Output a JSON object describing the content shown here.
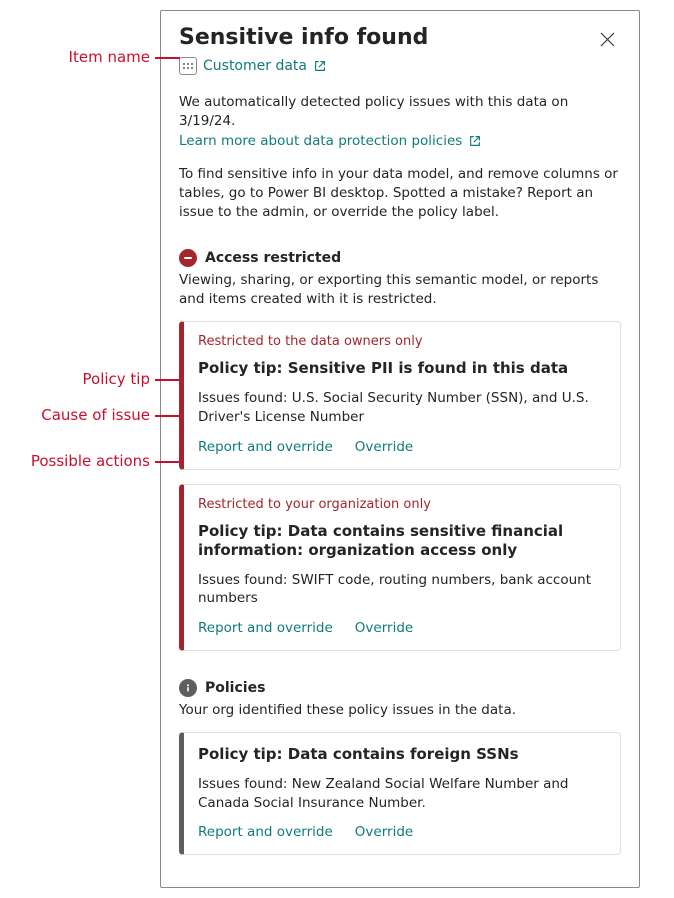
{
  "annotations": {
    "item_name": "Item name",
    "policy_tip": "Policy tip",
    "cause_of_issue": "Cause of issue",
    "possible_actions": "Possible actions"
  },
  "dialog": {
    "title": "Sensitive info found",
    "item_name": "Customer data",
    "detected_text": "We automatically detected policy issues with this data on 3/19/24.",
    "learn_more": "Learn more about data protection policies",
    "guidance": "To find sensitive info in your data model, and remove columns or tables, go to Power BI desktop. Spotted a mistake? Report an issue to the admin, or override the policy label."
  },
  "sections": {
    "restricted": {
      "heading": "Access restricted",
      "desc": "Viewing, sharing, or exporting this semantic model, or reports and items created with it is restricted."
    },
    "policies": {
      "heading": "Policies",
      "desc": "Your org identified these policy issues in the data."
    }
  },
  "cards": [
    {
      "restriction": "Restricted to the data owners only",
      "tip": "Policy tip: Sensitive PII is found in this data",
      "issues": "Issues found: U.S. Social Security Number (SSN), and U.S. Driver's License Number",
      "action1": "Report and override",
      "action2": "Override"
    },
    {
      "restriction": "Restricted to your organization only",
      "tip": "Policy tip: Data contains sensitive financial information: organization access only",
      "issues": "Issues found: SWIFT code, routing numbers, bank account numbers",
      "action1": "Report and override",
      "action2": "Override"
    },
    {
      "tip": "Policy tip: Data contains foreign SSNs",
      "issues": "Issues found: New Zealand Social Welfare Number and Canada Social Insurance Number.",
      "action1": "Report and override",
      "action2": "Override"
    }
  ]
}
